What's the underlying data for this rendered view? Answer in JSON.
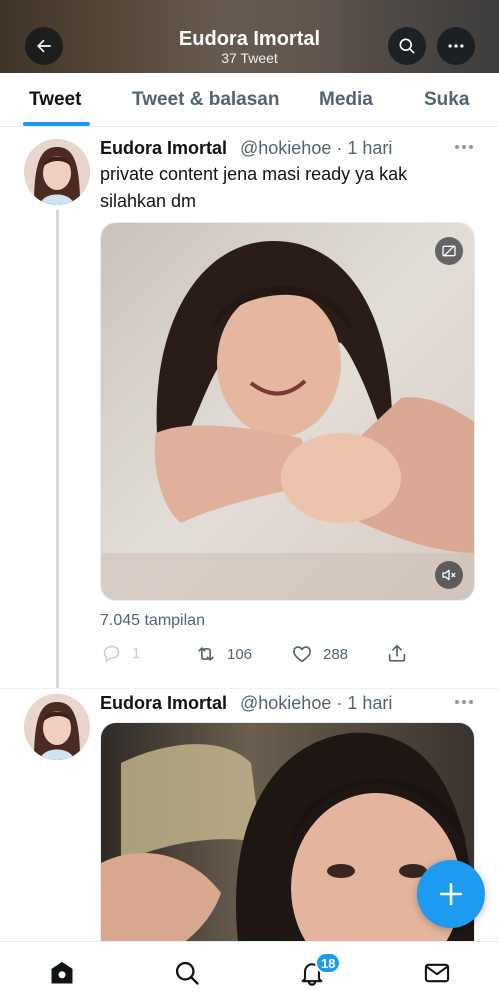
{
  "header": {
    "title": "Eudora Imortal",
    "subtitle": "37 Tweet",
    "back_icon": "arrow-left-icon",
    "search_icon": "search-icon",
    "more_icon": "more-horizontal-icon"
  },
  "tabs": [
    {
      "label": "Tweet",
      "active": true
    },
    {
      "label": "Tweet & balasan",
      "active": false
    },
    {
      "label": "Media",
      "active": false
    },
    {
      "label": "Suka",
      "active": false
    }
  ],
  "tweets": [
    {
      "name": "Eudora Imortal",
      "handle": "@hokiehoe · 1 hari",
      "text": "private content jena masi ready ya kak silahkan dm",
      "media_type": "video",
      "views": "7.045 tampilan",
      "replies": "1",
      "retweets": "106",
      "likes": "288"
    },
    {
      "name": "Eudora Imortal",
      "handle": "@hokiehoe · 1 hari",
      "media_type": "photo"
    }
  ],
  "bottom_nav": {
    "items": [
      "home-icon",
      "search-icon",
      "notifications-icon",
      "messages-icon"
    ],
    "notification_count": "18"
  },
  "colors": {
    "accent": "#1d9bf0",
    "text_primary": "#0f1419",
    "text_secondary": "#536471"
  }
}
